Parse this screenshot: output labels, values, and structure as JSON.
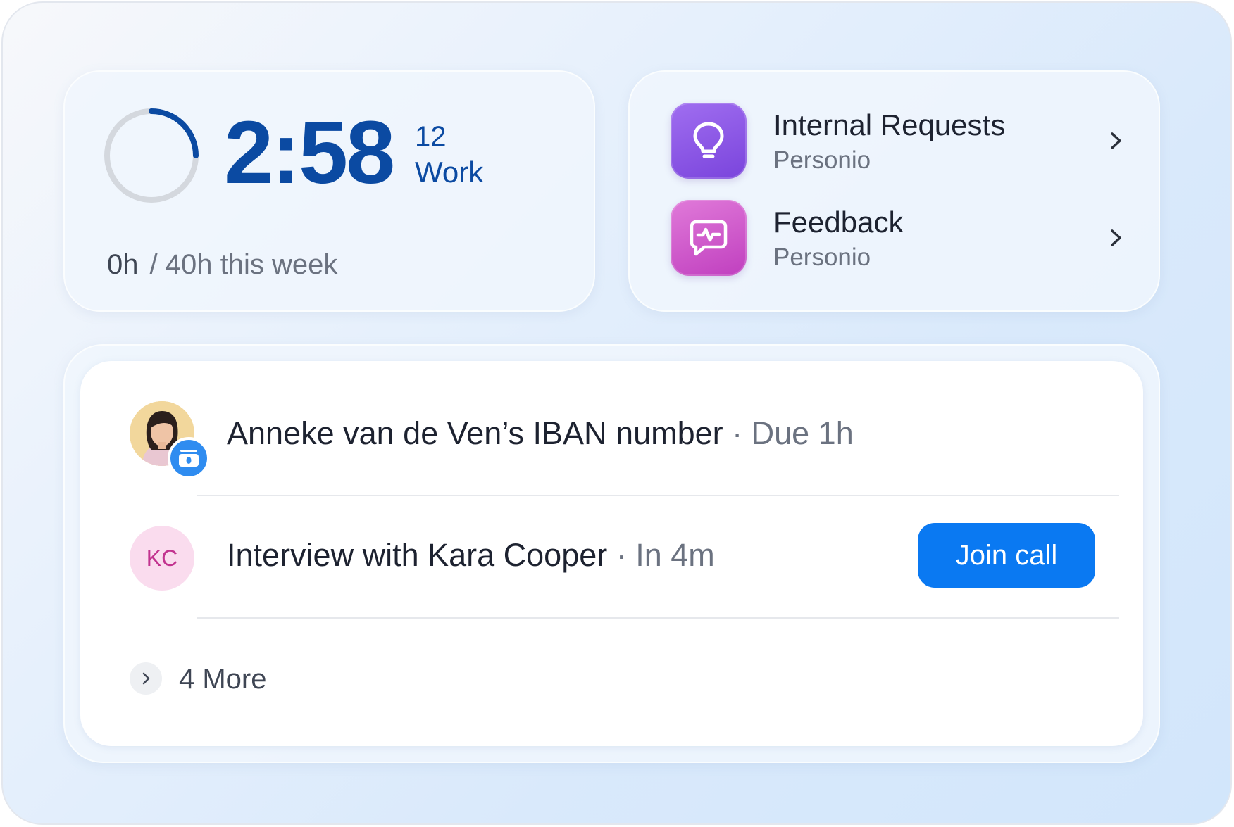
{
  "timer": {
    "clock": "2:58",
    "number": "12",
    "label": "Work",
    "hours_logged": "0h",
    "weekly_target": "/ 40h this week",
    "progress_fraction": 0.25
  },
  "apps": [
    {
      "title": "Internal Requests",
      "provider": "Personio",
      "icon": "lightbulb-icon"
    },
    {
      "title": "Feedback",
      "provider": "Personio",
      "icon": "chat-pulse-icon"
    }
  ],
  "tasks": [
    {
      "title": "Anneke van de Ven’s IBAN number",
      "meta": "· Due 1h",
      "avatar": "photo",
      "badge_icon": "bank-icon"
    },
    {
      "title": "Interview with Kara Cooper",
      "meta": "· In 4m",
      "initials": "KC",
      "action_label": "Join call"
    }
  ],
  "more_label": "4 More",
  "colors": {
    "primary_blue": "#0b4aa2",
    "button_blue": "#0a79f2",
    "purple": "#7a44dc",
    "pink": "#c03fbf"
  }
}
